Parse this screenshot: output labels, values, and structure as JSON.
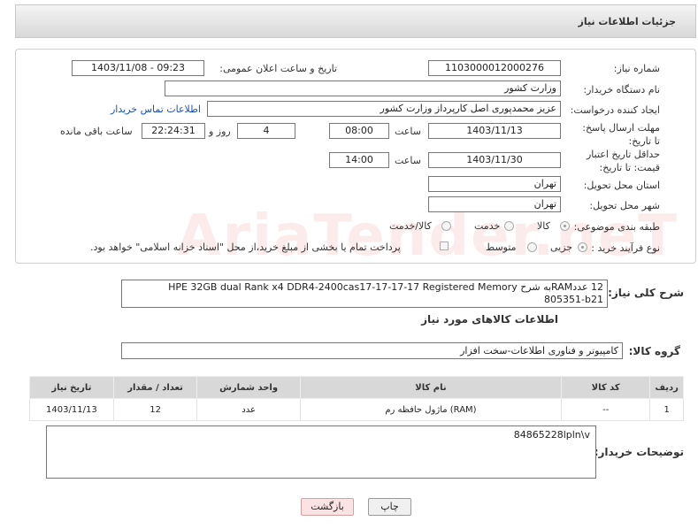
{
  "header": {
    "title": "جزئیات اطلاعات نیاز"
  },
  "form": {
    "need_number_label": "شماره نیاز:",
    "need_number": "1103000012000276",
    "announce_label": "تاریخ و ساعت اعلان عمومی:",
    "announce_value": "1403/11/08 - 09:23",
    "buyer_org_label": "نام دستگاه خریدار:",
    "buyer_org": "وزارت کشور",
    "requester_label": "ایجاد کننده درخواست:",
    "requester": "عزیز محمدپوری اصل کارپرداز وزارت کشور",
    "contact_link": "اطلاعات تماس خریدار",
    "deadline_label": "مهلت ارسال پاسخ: تا تاریخ:",
    "deadline_date": "1403/11/13",
    "time_label": "ساعت",
    "deadline_time": "08:00",
    "days_value": "4",
    "days_label": "روز و",
    "remaining_time": "22:24:31",
    "remaining_label": "ساعت باقی مانده",
    "validity_label": "حداقل تاریخ اعتبار قیمت: تا تاریخ:",
    "validity_date": "1403/11/30",
    "validity_time": "14:00",
    "province_label": "استان محل تحویل:",
    "province": "تهران",
    "city_label": "شهر محل تحویل:",
    "city": "تهران",
    "category_label": "طبقه بندی موضوعی:",
    "category_options": [
      "کالا",
      "خدمت",
      "کالا/خدمت"
    ],
    "process_label": "نوع فرآیند خرید :",
    "process_options": [
      "جزیی",
      "متوسط"
    ],
    "payment_note": "پرداخت تمام یا بخشی از مبلغ خرید،از محل \"اسناد خزانه اسلامی\" خواهد بود."
  },
  "description": {
    "label": "شرح کلی نیاز:",
    "text": "12 عددRAMبه شرح HPE 32GB dual Rank x4 DDR4-2400cas17-17-17-17 Registered Memory 805351-b21"
  },
  "goods_section": {
    "title": "اطلاعات کالاهای مورد نیاز",
    "group_label": "گروه کالا:",
    "group_value": "کامپیوتر و فناوری اطلاعات-سخت افزار"
  },
  "table": {
    "headers": [
      "ردیف",
      "کد کالا",
      "نام کالا",
      "واحد شمارش",
      "تعداد / مقدار",
      "تاریخ نیاز"
    ],
    "rows": [
      {
        "row": "1",
        "code": "--",
        "name": "ماژول حافظه رم (RAM)",
        "unit": "عدد",
        "qty": "12",
        "date": "1403/11/13"
      }
    ]
  },
  "notes": {
    "label": "توضیحات خریدار:",
    "text": "84865228lpln\\v"
  },
  "buttons": {
    "print": "چاپ",
    "back": "بازگشت"
  },
  "watermark": "AriaTender.neT",
  "colors": {
    "link": "#1a4fb4",
    "back_button_bg": "#fbe3e3",
    "header_bg": "#e0e0e0"
  }
}
